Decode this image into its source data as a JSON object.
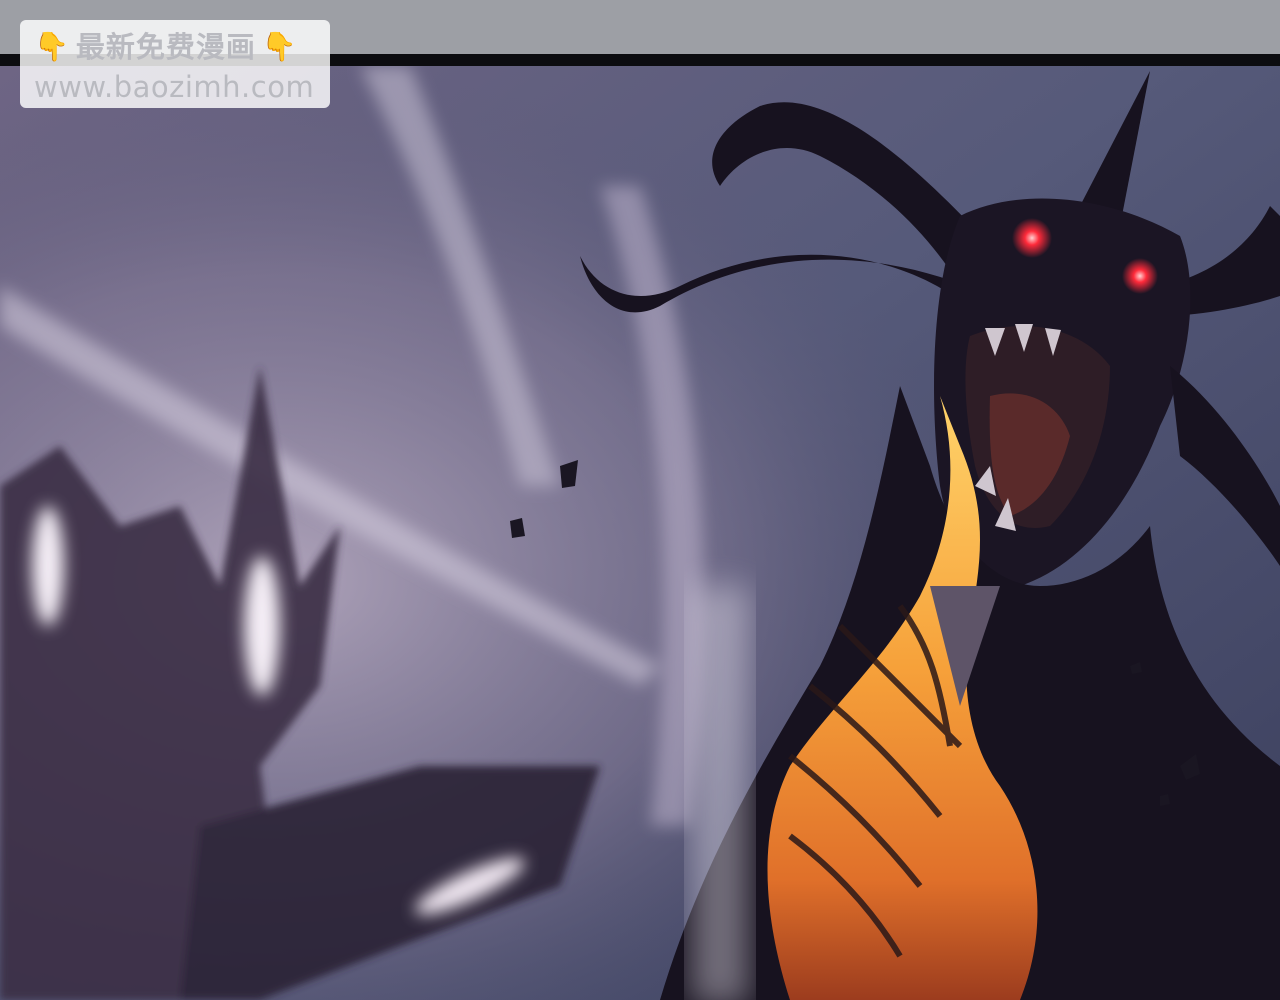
{
  "watermark": {
    "title": "最新免费漫画",
    "url": "www.baozimh.com",
    "icon_left": "pointing-down-hand-icon",
    "icon_right": "pointing-down-hand-icon",
    "hand_glyph": "👇"
  },
  "colors": {
    "sky": "#4a4f6e",
    "creature_silhouette": "#17121f",
    "glow": "#f3a43a",
    "eyes": "#ff2a3a",
    "blur_left": "#8a7f98"
  }
}
